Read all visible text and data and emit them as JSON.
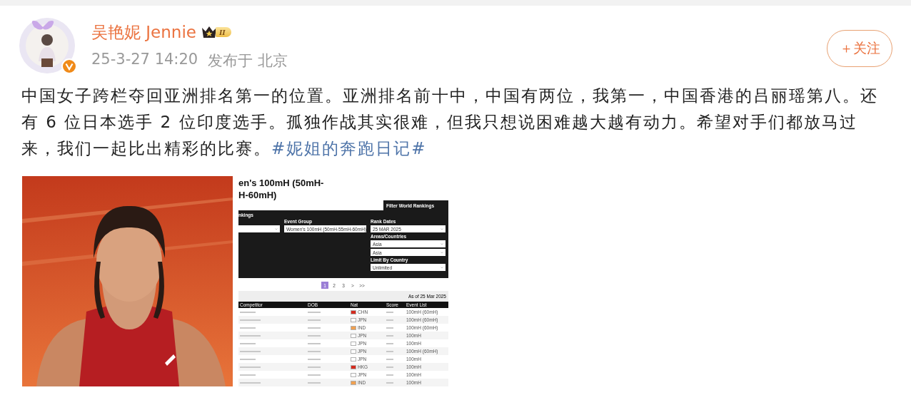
{
  "post": {
    "author": {
      "name": "吴艳妮 Jennie",
      "level_badge": "II"
    },
    "meta": {
      "time": "25-3-27 14:20",
      "location": "发布于 北京"
    },
    "follow_button": "＋关注",
    "text": "中国女子跨栏夺回亚洲排名第一的位置。亚洲排名前十中，中国有两位，我第一，中国香港的吕丽瑶第八。还有 6 位日本选手 2 位印度选手。孤独作战其实很难，但我只想说困难越大越有动力。希望对手们都放马过来，我们一起比出精彩的比赛。",
    "hashtag": "#妮姐的奔跑日记#",
    "images": [
      {
        "kind": "picture"
      },
      {
        "kind": "screenshot",
        "title_lines": [
          "en's 100mH (50mH-",
          "H-60mH)"
        ],
        "filter_tab": "Filter World Rankings",
        "panel_label": "nkings",
        "event_group": {
          "label": "Event Group",
          "value": "Women's 100mH (50mH-55mH-60mH)"
        },
        "rank_dates": {
          "label": "Rank Dates",
          "value": "25 MAR 2025"
        },
        "areas": {
          "label": "Areas/Countries",
          "values": [
            "Asia",
            "Asia"
          ]
        },
        "limit": {
          "label": "Limit By Country",
          "value": "Unlimited"
        },
        "pages": [
          {
            "label": "1",
            "selected": true
          },
          {
            "label": "2",
            "selected": false
          },
          {
            "label": "3",
            "selected": false
          },
          {
            "label": ">",
            "selected": false
          },
          {
            "label": ">>",
            "selected": false
          }
        ],
        "as_of": "As of 25 Mar 2025",
        "columns": [
          "Competitor",
          "DOB",
          "Nat",
          "Score",
          "Event List"
        ],
        "rows": [
          {
            "nat": "CHN",
            "color": "#d52b1e",
            "event": "100mH (60mH)"
          },
          {
            "nat": "JPN",
            "color": "#ffffff",
            "event": "100mH (60mH)"
          },
          {
            "nat": "IND",
            "color": "#f0a050",
            "event": "100mH (60mH)"
          },
          {
            "nat": "JPN",
            "color": "#ffffff",
            "event": "100mH"
          },
          {
            "nat": "JPN",
            "color": "#ffffff",
            "event": "100mH"
          },
          {
            "nat": "JPN",
            "color": "#ffffff",
            "event": "100mH (60mH)"
          },
          {
            "nat": "JPN",
            "color": "#ffffff",
            "event": "100mH"
          },
          {
            "nat": "HKG",
            "color": "#d52b1e",
            "event": "100mH"
          },
          {
            "nat": "JPN",
            "color": "#ffffff",
            "event": "100mH"
          },
          {
            "nat": "IND",
            "color": "#f0a050",
            "event": "100mH"
          }
        ]
      }
    ]
  }
}
